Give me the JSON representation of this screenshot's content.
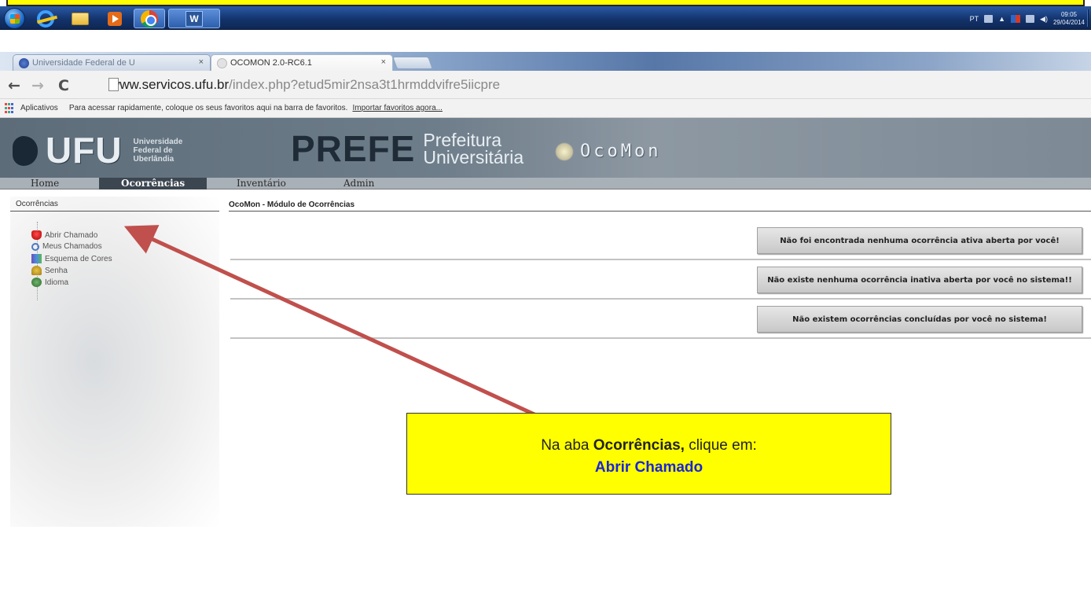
{
  "taskbar": {
    "tray": {
      "lang": "PT",
      "time": "09:05",
      "date": "29/04/2014"
    },
    "pinned": [
      "start-orb-icon",
      "internet-explorer-icon",
      "explorer-folder-icon",
      "media-player-icon",
      "chrome-icon",
      "word-icon"
    ],
    "word_label": "W"
  },
  "browser": {
    "tabs": [
      {
        "title": "Universidade Federal de U",
        "close": "×"
      },
      {
        "title": "OCOMON 2.0-RC6.1",
        "close": "×"
      }
    ],
    "nav": {
      "back": "←",
      "forward": "→",
      "reload": "C"
    },
    "url_host": "www.servicos.ufu.br",
    "url_path": "/index.php?etud5mir2nsa3t1hrmddvifre5iicpre",
    "bookmarks": {
      "apps": "Aplicativos",
      "hint": "Para acessar rapidamente, coloque os seus favoritos aqui na barra de favoritos.",
      "import": "Importar favoritos agora..."
    }
  },
  "header": {
    "ufu": "UFU",
    "ufu_sub": [
      "Universidade",
      "Federal de",
      "Uberlândia"
    ],
    "prefe": "PREFE",
    "prefe_sub": [
      "Prefeitura",
      "Universitária"
    ],
    "ocomon": "OcoMon"
  },
  "menu": {
    "home": "Home",
    "ocorrencias": "Ocorrências",
    "inventario": "Inventário",
    "admin": "Admin"
  },
  "sidebar": {
    "title": "Ocorrências",
    "items": [
      {
        "label": "Abrir Chamado",
        "icon": "bell-icon"
      },
      {
        "label": "Meus Chamados",
        "icon": "search-icon"
      },
      {
        "label": "Esquema de Cores",
        "icon": "palette-icon"
      },
      {
        "label": "Senha",
        "icon": "key-icon"
      },
      {
        "label": "Idioma",
        "icon": "globe-icon"
      }
    ]
  },
  "main": {
    "title": "OcoMon - Módulo de Ocorrências",
    "messages": [
      "Não foi encontrada nenhuma ocorrência ativa aberta por você!",
      "Não existe nenhuma ocorrência inativa aberta por você no sistema!!",
      "Não existem ocorrências concluídas por você no sistema!"
    ]
  },
  "annotation": {
    "prefix": "Na aba ",
    "tab": "Ocorrências,",
    "suffix": " clique em:",
    "action": "Abrir Chamado"
  },
  "colors": {
    "annotation_bg": "#ffff00",
    "arrow": "#c0504d",
    "link": "#1a25d6",
    "menu_active": "#3c4650"
  }
}
